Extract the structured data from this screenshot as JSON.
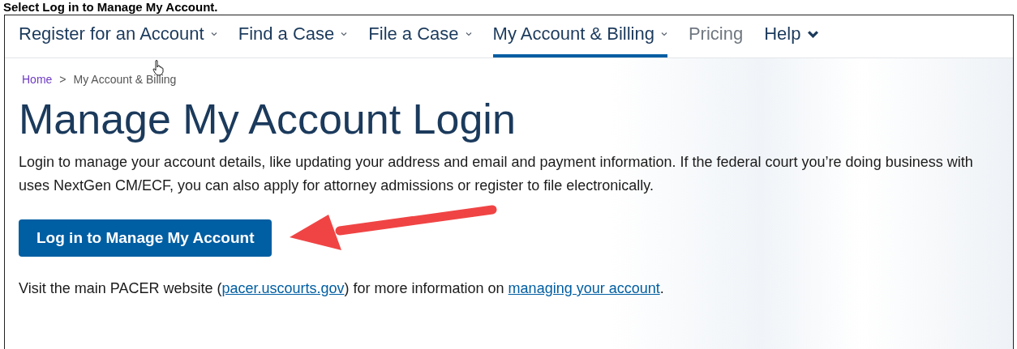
{
  "caption": "Select Log in to Manage My Account.",
  "nav": [
    {
      "label": "Register for an Account",
      "kind": "dropdown",
      "selected": false,
      "dimmed": false
    },
    {
      "label": "Find a Case",
      "kind": "dropdown",
      "selected": false,
      "dimmed": false
    },
    {
      "label": "File a Case",
      "kind": "dropdown",
      "selected": false,
      "dimmed": false
    },
    {
      "label": "My Account & Billing",
      "kind": "dropdown",
      "selected": true,
      "dimmed": false
    },
    {
      "label": "Pricing",
      "kind": "link",
      "selected": false,
      "dimmed": true
    },
    {
      "label": "Help",
      "kind": "menu",
      "selected": false,
      "dimmed": false
    }
  ],
  "breadcrumb": [
    {
      "label": "Home",
      "link": true
    },
    {
      "label": ">",
      "link": false
    },
    {
      "label": "My Account & Billing",
      "link": false
    }
  ],
  "heading": "Manage My Account Login",
  "intro": "Login to manage your account details, like updating your address and email and payment information. If the federal court you’re doing business with uses NextGen CM/ECF, you can also apply for attorney admissions or register to file electronically.",
  "button": "Log in to Manage My Account",
  "footer": {
    "before": "Visit the main PACER website (",
    "link1": "pacer.uscourts.gov",
    "middle": ") for more information on ",
    "link2": "managing your account",
    "after": "."
  }
}
